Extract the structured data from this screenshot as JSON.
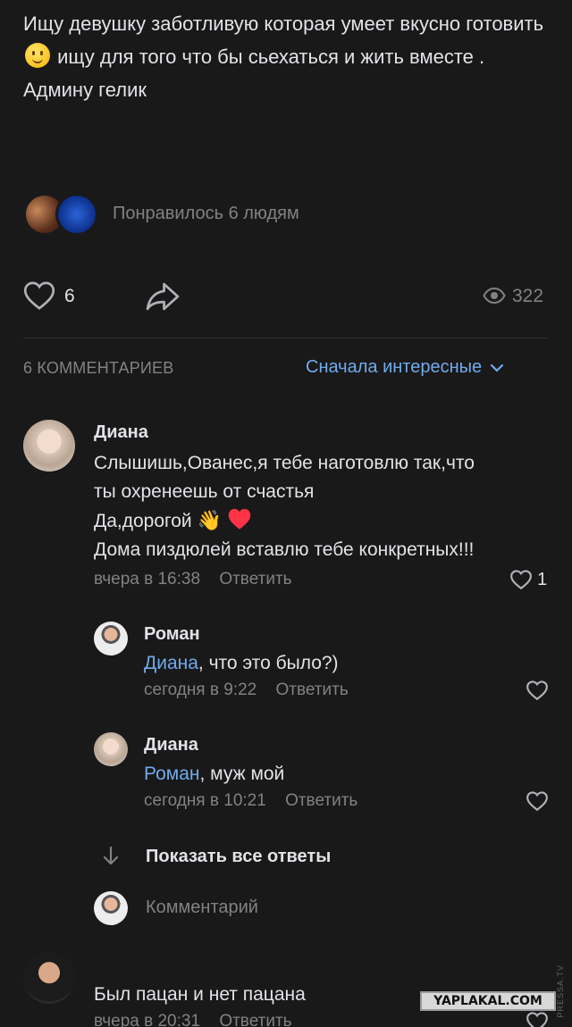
{
  "post": {
    "text_part1": "Ищу девушку заботливую которая умеет вкусно готовить",
    "text_part2": "ищу для того что бы сьехаться и жить вместе . Админу гелик",
    "emoji": "slightly-smiling-face",
    "liked_by": "Понравилось 6 людям"
  },
  "actions": {
    "likes": "6",
    "views": "322"
  },
  "comments_section": {
    "count_label": "6 КОММЕНТАРИЕВ",
    "sort_label": "Сначала интересные"
  },
  "comments": [
    {
      "author": "Диана",
      "lines": [
        "Слышишь,Ованес,я тебе наготовлю так,что",
        "ты охренеешь от счастья",
        "Да,дорогой",
        "Дома пиздюлей вставлю тебе конкретных!!!"
      ],
      "time": "вчера в 16:38",
      "reply": "Ответить",
      "likes": "1"
    },
    {
      "author": "Роман",
      "mention": "Диана",
      "text": ", что это было?)",
      "time": "сегодня в 9:22",
      "reply": "Ответить"
    },
    {
      "author": "Диана",
      "mention": "Роман",
      "text": ", муж мой",
      "time": "сегодня в 10:21",
      "reply": "Ответить"
    },
    {
      "text": "Был пацан и нет пацана",
      "time": "вчера в 20:31",
      "reply": "Ответить"
    }
  ],
  "thread": {
    "show_all": "Показать все ответы",
    "comment_placeholder": "Комментарий"
  },
  "watermark": "YAPLAKAL.COM",
  "side_mark": "PRESSA.TV",
  "colors": {
    "background": "#19191a",
    "text": "#e1e3e6",
    "secondary": "#828282",
    "accent": "#71aaeb",
    "like_red": "#ff3347"
  }
}
